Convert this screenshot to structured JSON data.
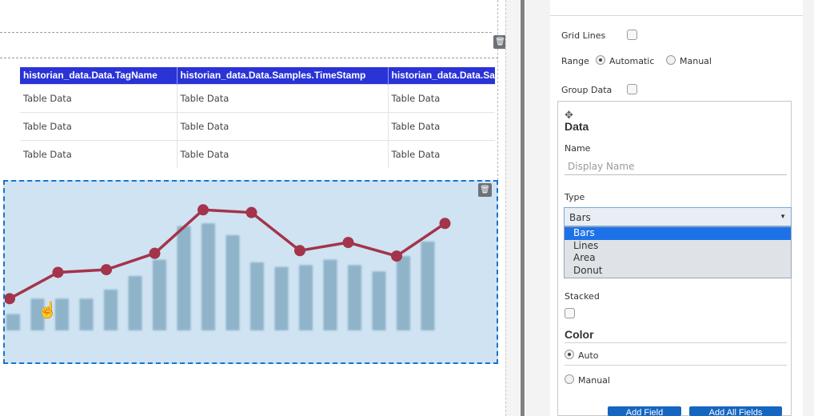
{
  "table": {
    "columns": [
      "historian_data.Data.TagName",
      "historian_data.Data.Samples.TimeStamp",
      "historian_data.Data.Samples.Value"
    ],
    "rows": [
      [
        "Table Data",
        "Table Data",
        "Table Data"
      ],
      [
        "Table Data",
        "Table Data",
        "Table Data"
      ],
      [
        "Table Data",
        "Table Data",
        "Table Data"
      ]
    ]
  },
  "icons": {
    "delete": "trash-icon",
    "cursor": "hand-pointer-icon",
    "move": "move-icon",
    "caret": "chevron-down-icon"
  },
  "chart_data": {
    "type": "bar",
    "note_series": [
      "bars",
      "line"
    ],
    "bar_values": [
      18,
      35,
      35,
      35,
      45,
      60,
      78,
      115,
      118,
      105,
      75,
      70,
      72,
      78,
      72,
      65,
      82,
      98
    ],
    "line_values": [
      35,
      64,
      67,
      85,
      133,
      130,
      88,
      97,
      82,
      118
    ],
    "ylim": [
      0,
      150
    ],
    "colors": {
      "bars": "#8fb3c9",
      "line": "#a3344b",
      "background": "#cfe3f2"
    }
  },
  "panel": {
    "grid_lines_label": "Grid Lines",
    "range_label": "Range",
    "range_automatic": "Automatic",
    "range_manual": "Manual",
    "group_data_label": "Group Data",
    "data_title": "Data",
    "name_label": "Name",
    "name_placeholder": "Display Name",
    "type_label": "Type",
    "type_value": "Bars",
    "type_options": [
      "Bars",
      "Lines",
      "Area",
      "Donut"
    ],
    "stacked_label": "Stacked",
    "color_title": "Color",
    "color_auto": "Auto",
    "color_manual": "Manual",
    "add_field_button": "Add Field",
    "add_all_fields_button": "Add All Fields"
  },
  "colors": {
    "table_header": "#2a33d6",
    "selected_option": "#1e72e8",
    "chart_border": "#1b74c9"
  }
}
